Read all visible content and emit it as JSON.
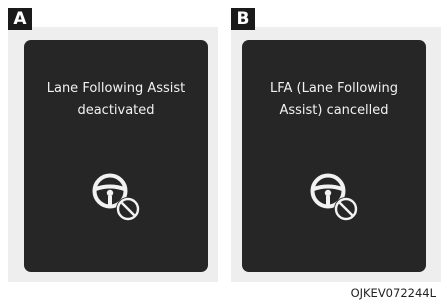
{
  "panels": [
    {
      "tag": "A",
      "message_lines": [
        "Lane Following Assist",
        "deactivated"
      ],
      "icon": "steering-wheel-cancelled-icon"
    },
    {
      "tag": "B",
      "message_lines": [
        "LFA (Lane Following",
        "Assist) cancelled"
      ],
      "icon": "steering-wheel-cancelled-icon"
    }
  ],
  "figure_code": "OJKEV072244L",
  "colors": {
    "screen": "#262626",
    "panel_background": "#eeeeee",
    "text": "#f2f2f2",
    "icon": "#f2f2f2",
    "tag_background": "#1a1a1a"
  }
}
